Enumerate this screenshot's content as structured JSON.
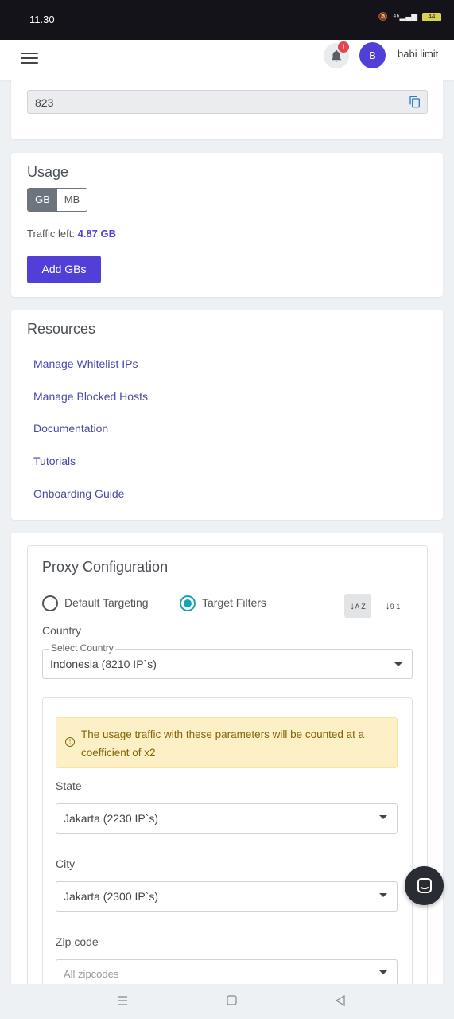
{
  "status_bar": {
    "time": "11.30",
    "signal": "⁴⁶",
    "battery": "44"
  },
  "header": {
    "notification_count": "1",
    "avatar_initial": "B",
    "username": "babi limit"
  },
  "port_card": {
    "value": "823"
  },
  "usage": {
    "title": "Usage",
    "units": [
      "GB",
      "MB"
    ],
    "selected_unit": "GB",
    "traffic_label": "Traffic left:",
    "traffic_value": "4.87 GB",
    "add_button": "Add GBs"
  },
  "resources": {
    "title": "Resources",
    "links": [
      "Manage Whitelist IPs",
      "Manage Blocked Hosts",
      "Documentation",
      "Tutorials",
      "Onboarding Guide"
    ]
  },
  "proxy_config": {
    "title": "Proxy Configuration",
    "targeting_options": [
      "Default Targeting",
      "Target Filters"
    ],
    "selected_targeting": "Target Filters",
    "sort_az_label": "A Z",
    "sort_91_label": "9 1",
    "country_label": "Country",
    "country_select_legend": "Select Country",
    "country_value": "Indonesia (8210 IP`s)",
    "alert_text": "The usage traffic with these parameters will be counted at a coefficient of x2",
    "state_label": "State",
    "state_value": "Jakarta (2230 IP`s)",
    "city_label": "City",
    "city_value": "Jakarta (2300 IP`s)",
    "zip_label": "Zip code",
    "zip_placeholder": "All zipcodes"
  },
  "colors": {
    "accent": "#5140d8",
    "radio_active": "#17a2b8",
    "alert_bg": "#fdf0c7"
  }
}
